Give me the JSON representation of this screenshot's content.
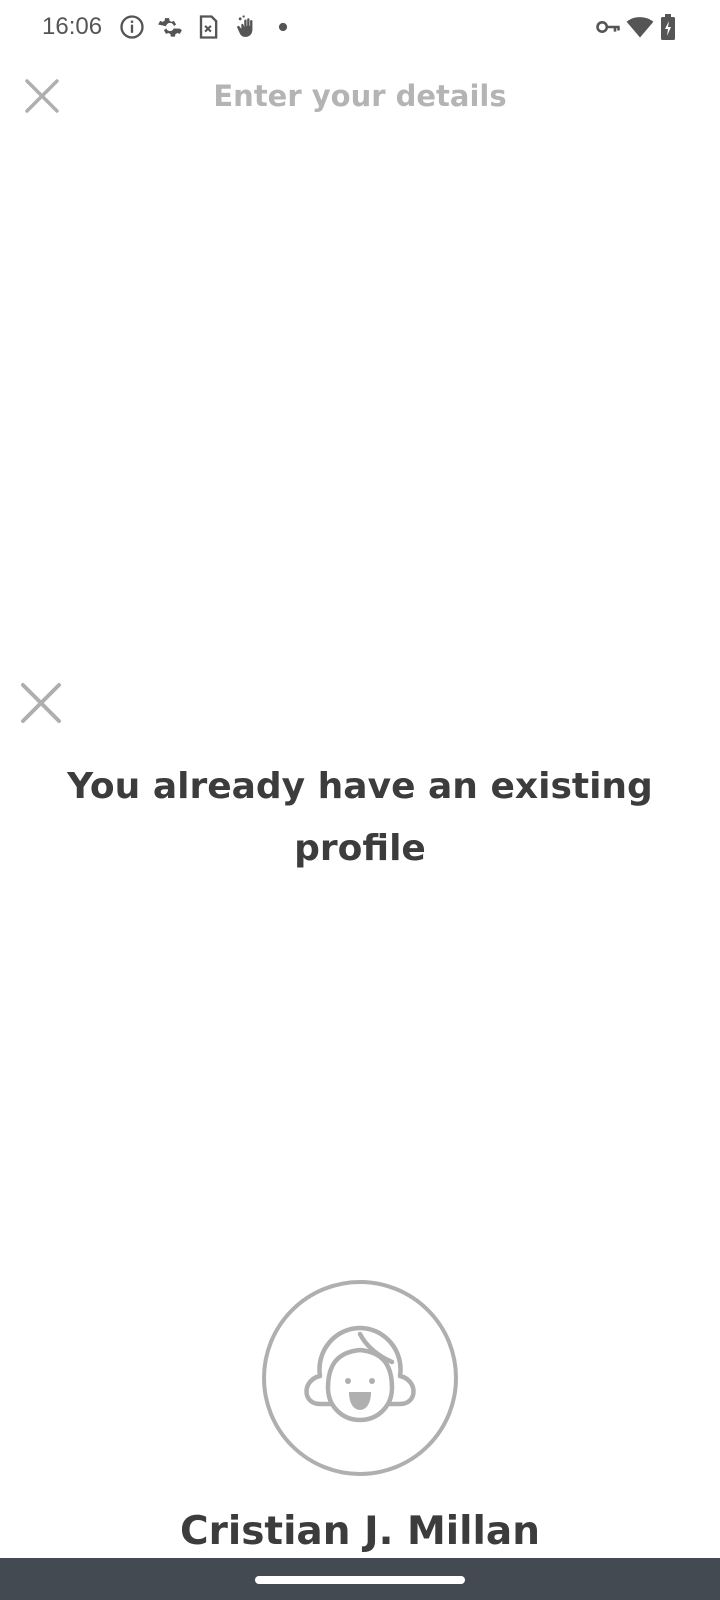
{
  "status_bar": {
    "time": "16:06",
    "icons": [
      "info-icon",
      "settings-gear-icon",
      "sim-card-x-icon",
      "hand-icon",
      "dot-icon",
      "vpn-key-icon",
      "wifi-icon",
      "battery-charging-icon"
    ]
  },
  "header": {
    "title": "Enter your details",
    "close_icon": "close-icon"
  },
  "sheet": {
    "close_icon": "close-icon",
    "heading": "You already have an existing profile",
    "avatar_icon": "avatar-face-icon",
    "profile_name": "Cristian J. Millan"
  },
  "colors": {
    "text_dark": "#3c3c3c",
    "text_muted": "#b4b4b4",
    "icon_gray": "#afafaf",
    "nav_bar": "#434a52"
  }
}
